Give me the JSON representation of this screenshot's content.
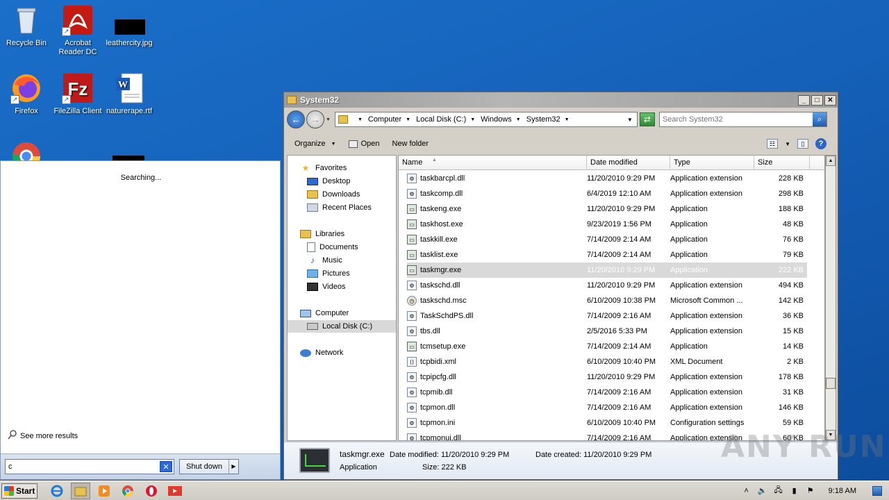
{
  "desktop": {
    "icons": [
      {
        "label": "Recycle Bin",
        "icon": "recycle-bin-icon"
      },
      {
        "label": "Acrobat Reader DC",
        "icon": "acrobat-icon"
      },
      {
        "label": "leathercity.jpg",
        "icon": "image-file-icon"
      },
      {
        "label": "Firefox",
        "icon": "firefox-icon"
      },
      {
        "label": "FileZilla Client",
        "icon": "filezilla-icon"
      },
      {
        "label": "naturerape.rtf",
        "icon": "word-document-icon"
      }
    ]
  },
  "start_menu": {
    "status": "Searching...",
    "see_more": "See more results",
    "search_value": "c",
    "shutdown_label": "Shut down"
  },
  "explorer": {
    "title": "System32",
    "breadcrumbs": [
      "Computer",
      "Local Disk (C:)",
      "Windows",
      "System32"
    ],
    "search_placeholder": "Search System32",
    "toolbar": {
      "organize": "Organize",
      "open": "Open",
      "new_folder": "New folder"
    },
    "nav": {
      "favorites": "Favorites",
      "desktop": "Desktop",
      "downloads": "Downloads",
      "recent_places": "Recent Places",
      "libraries": "Libraries",
      "documents": "Documents",
      "music": "Music",
      "pictures": "Pictures",
      "videos": "Videos",
      "computer": "Computer",
      "local_disk": "Local Disk (C:)",
      "network": "Network"
    },
    "columns": {
      "name": "Name",
      "date": "Date modified",
      "type": "Type",
      "size": "Size"
    },
    "files": [
      {
        "name": "taskbarcpl.dll",
        "date": "11/20/2010 9:29 PM",
        "type": "Application extension",
        "size": "228 KB",
        "kind": "dll"
      },
      {
        "name": "taskcomp.dll",
        "date": "6/4/2019 12:10 AM",
        "type": "Application extension",
        "size": "298 KB",
        "kind": "dll"
      },
      {
        "name": "taskeng.exe",
        "date": "11/20/2010 9:29 PM",
        "type": "Application",
        "size": "188 KB",
        "kind": "exe"
      },
      {
        "name": "taskhost.exe",
        "date": "9/23/2019 1:56 PM",
        "type": "Application",
        "size": "48 KB",
        "kind": "exe"
      },
      {
        "name": "taskkill.exe",
        "date": "7/14/2009 2:14 AM",
        "type": "Application",
        "size": "76 KB",
        "kind": "exe"
      },
      {
        "name": "tasklist.exe",
        "date": "7/14/2009 2:14 AM",
        "type": "Application",
        "size": "79 KB",
        "kind": "exe"
      },
      {
        "name": "taskmgr.exe",
        "date": "11/20/2010 9:29 PM",
        "type": "Application",
        "size": "222 KB",
        "kind": "exe"
      },
      {
        "name": "taskschd.dll",
        "date": "11/20/2010 9:29 PM",
        "type": "Application extension",
        "size": "494 KB",
        "kind": "dll"
      },
      {
        "name": "taskschd.msc",
        "date": "6/10/2009 10:38 PM",
        "type": "Microsoft Common ...",
        "size": "142 KB",
        "kind": "msc"
      },
      {
        "name": "TaskSchdPS.dll",
        "date": "7/14/2009 2:16 AM",
        "type": "Application extension",
        "size": "36 KB",
        "kind": "dll"
      },
      {
        "name": "tbs.dll",
        "date": "2/5/2016 5:33 PM",
        "type": "Application extension",
        "size": "15 KB",
        "kind": "dll"
      },
      {
        "name": "tcmsetup.exe",
        "date": "7/14/2009 2:14 AM",
        "type": "Application",
        "size": "14 KB",
        "kind": "exe"
      },
      {
        "name": "tcpbidi.xml",
        "date": "6/10/2009 10:40 PM",
        "type": "XML Document",
        "size": "2 KB",
        "kind": "xml"
      },
      {
        "name": "tcpipcfg.dll",
        "date": "11/20/2010 9:29 PM",
        "type": "Application extension",
        "size": "178 KB",
        "kind": "dll"
      },
      {
        "name": "tcpmib.dll",
        "date": "7/14/2009 2:16 AM",
        "type": "Application extension",
        "size": "31 KB",
        "kind": "dll"
      },
      {
        "name": "tcpmon.dll",
        "date": "7/14/2009 2:16 AM",
        "type": "Application extension",
        "size": "146 KB",
        "kind": "dll"
      },
      {
        "name": "tcpmon.ini",
        "date": "6/10/2009 10:40 PM",
        "type": "Configuration settings",
        "size": "59 KB",
        "kind": "ini"
      },
      {
        "name": "tcpmonui.dll",
        "date": "7/14/2009 2:16 AM",
        "type": "Application extension",
        "size": "60 KB",
        "kind": "dll"
      }
    ],
    "selected_file": "taskmgr.exe",
    "details": {
      "name": "taskmgr.exe",
      "date_modified": "Date modified:  11/20/2010 9:29 PM",
      "date_created": "Date created:  11/20/2010 9:29 PM",
      "type": "Application",
      "size": "Size:  222 KB"
    }
  },
  "taskbar": {
    "start_label": "Start",
    "clock": "9:18 AM"
  },
  "watermark": "ANY RUN"
}
